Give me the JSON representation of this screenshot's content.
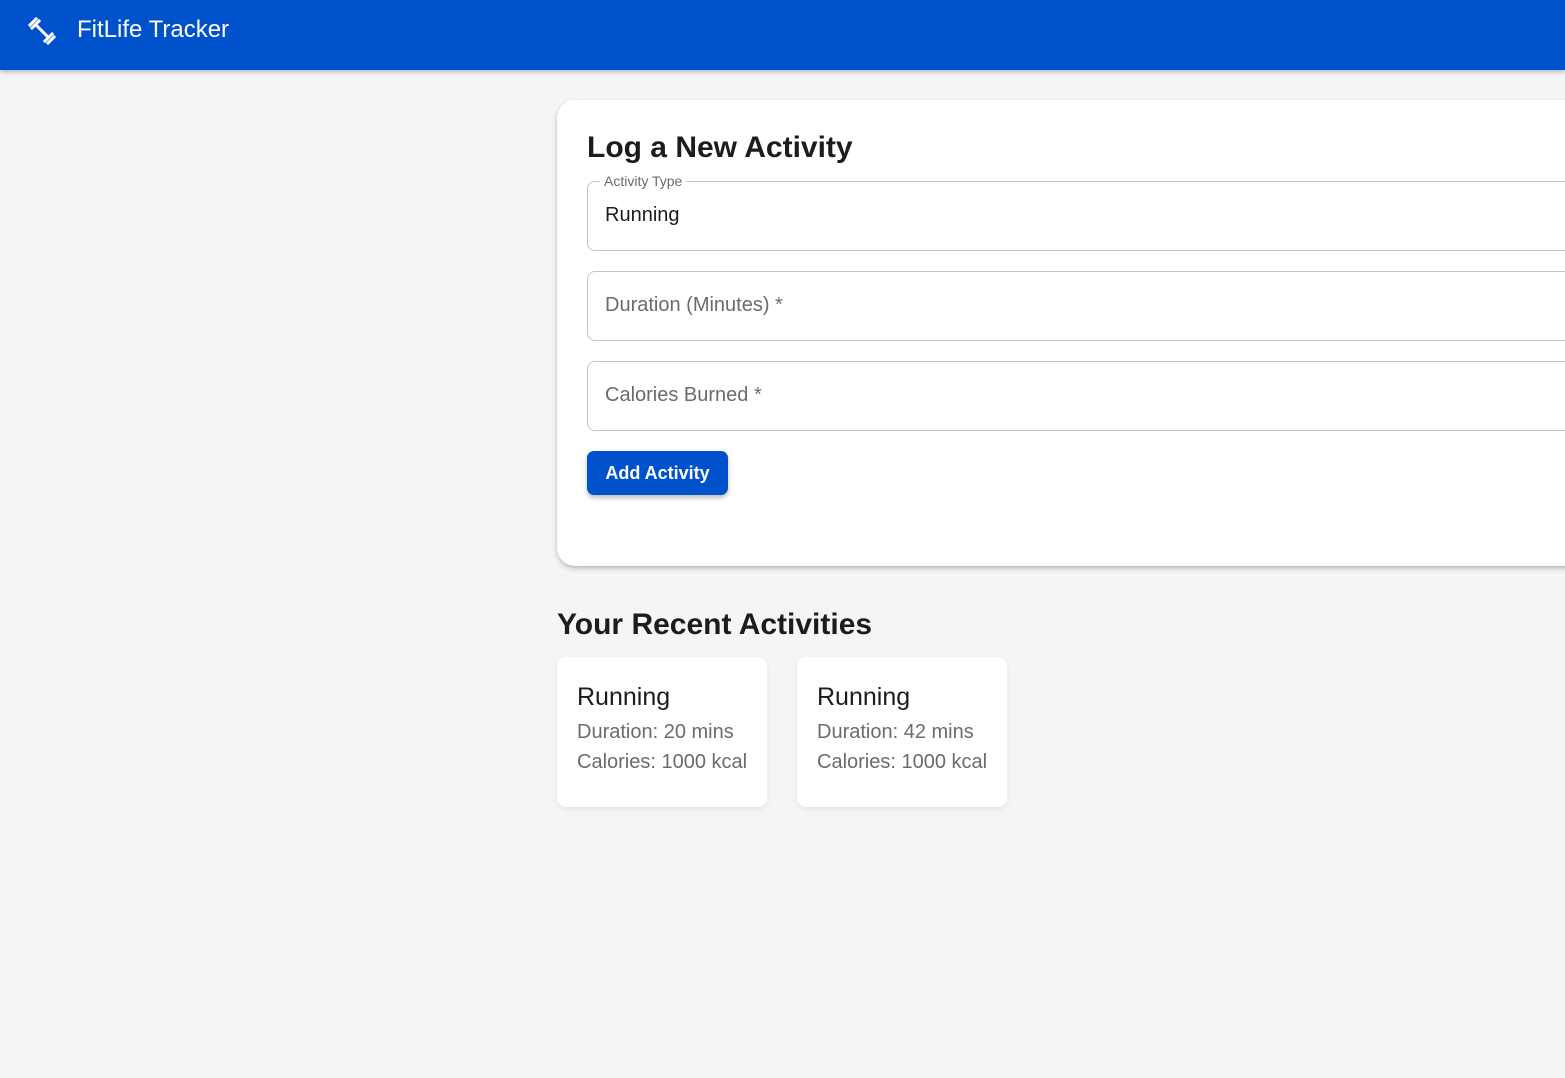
{
  "header": {
    "app_title": "FitLife Tracker",
    "logo_icon": "dumbbell-icon",
    "background_color": "#0052cc"
  },
  "form": {
    "title": "Log a New Activity",
    "activity_type": {
      "label": "Activity Type",
      "value": "Running"
    },
    "duration": {
      "placeholder": "Duration (Minutes) *"
    },
    "calories": {
      "placeholder": "Calories Burned *"
    },
    "submit_label": "Add Activity"
  },
  "recent": {
    "title": "Your Recent Activities",
    "activities": [
      {
        "name": "Running",
        "duration_text": "Duration: 20 mins",
        "calories_text": "Calories: 1000 kcal"
      },
      {
        "name": "Running",
        "duration_text": "Duration: 42 mins",
        "calories_text": "Calories: 1000 kcal"
      }
    ]
  }
}
